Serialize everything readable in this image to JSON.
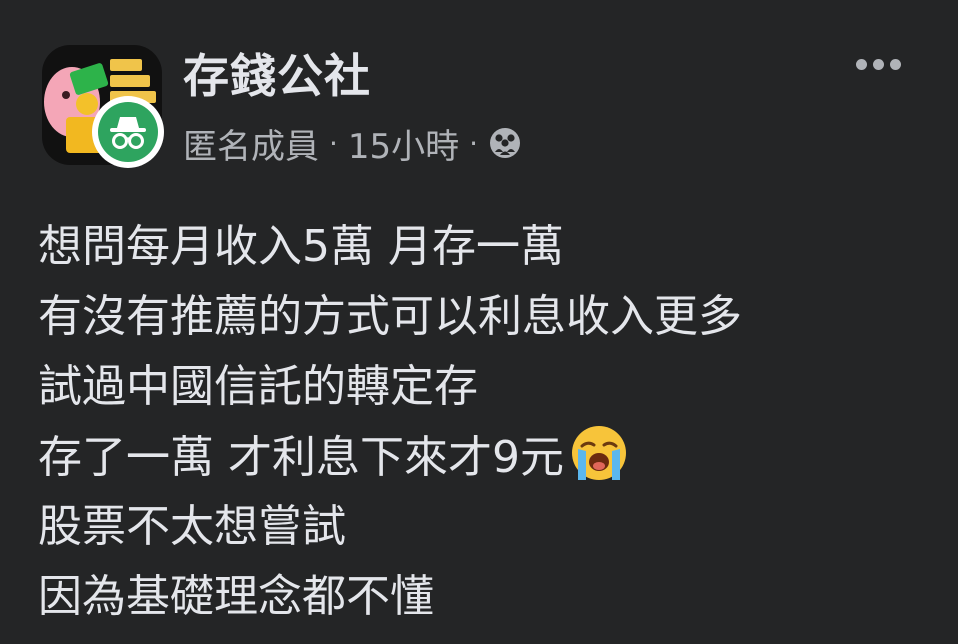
{
  "post": {
    "group_name": "存錢公社",
    "author": "匿名成員",
    "separator": "·",
    "time": "15小時",
    "audience_icon": "group-members-icon",
    "more_icon": "more-options-icon",
    "avatar_icon": "group-avatar-icon",
    "anonymous_icon": "anonymous-member-icon",
    "body_lines": [
      "想問每月收入5萬 月存一萬",
      "有沒有推薦的方式可以利息收入更多",
      "試過中國信託的轉定存",
      "存了一萬 才利息下來才9元",
      "股票不太想嘗試",
      "因為基礎理念都不懂"
    ],
    "emoji": "loudly-crying-face-icon"
  },
  "colors": {
    "background": "#242526",
    "primary_text": "#e4e6eb",
    "secondary_text": "#b0b3b8",
    "anonymous_badge": "#2ea45f"
  }
}
